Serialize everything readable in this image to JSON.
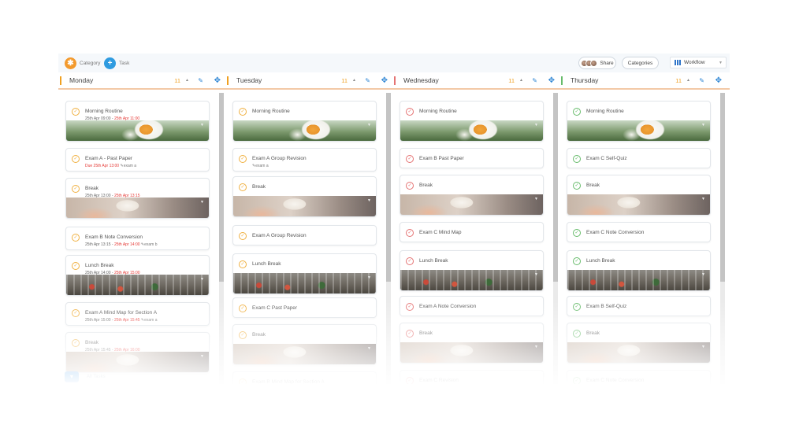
{
  "toolbar": {
    "category_label": "Category",
    "task_label": "Task",
    "share_label": "Share",
    "categories_label": "Categories",
    "view_label": "Workflow"
  },
  "filter": {
    "label": "All Tasks"
  },
  "colors": {
    "accent_orange": "#f0a020",
    "brand_blue": "#2f86d4",
    "done_red": "#e57373",
    "done_green": "#66bb6a",
    "due_red": "#e53935"
  },
  "columns": [
    {
      "title": "Monday",
      "count": "11",
      "accent": "#f0a020",
      "check_color": "#f0b040",
      "cards": [
        {
          "title": "Morning Routine",
          "sub_start": "25th Apr 09:00",
          "sub_sep": " - ",
          "sub_end": "25th Apr 11:00",
          "image": "daisy"
        },
        {
          "title": "Exam A - Past Paper",
          "sub_start": "Due 25th Apr 13:00",
          "sub_tag": "exam a"
        },
        {
          "title": "Break",
          "sub_start": "25th Apr 13:00",
          "sub_sep": " - ",
          "sub_end": "25th Apr 13:15",
          "image": "coffee"
        },
        {
          "title": "Exam B Note Conversion",
          "sub_start": "25th Apr 13:15",
          "sub_sep": " - ",
          "sub_end": "25th Apr 14:00",
          "sub_tag": "exam b"
        },
        {
          "title": "Lunch Break",
          "sub_start": "25th Apr 14:00",
          "sub_sep": " - ",
          "sub_end": "25th Apr 15:00",
          "image": "cafe"
        },
        {
          "title": "Exam A Mind Map for Section A",
          "sub_start": "25th Apr 15:00",
          "sub_sep": " - ",
          "sub_end": "25th Apr 15:45",
          "sub_tag": "exam a"
        },
        {
          "title": "Break",
          "sub_start": "25th Apr 15:45",
          "sub_sep": " - ",
          "sub_end": "25th Apr 16:00",
          "image": "coffee"
        }
      ]
    },
    {
      "title": "Tuesday",
      "count": "11",
      "accent": "#f0a020",
      "check_color": "#f0b040",
      "cards": [
        {
          "title": "Morning Routine",
          "image": "daisy"
        },
        {
          "title": "Exam A Group Revision",
          "sub_tag": "exam a"
        },
        {
          "title": "Break",
          "image": "coffee"
        },
        {
          "title": "Exam A Group Revision"
        },
        {
          "title": "Lunch Break",
          "image": "cafe"
        },
        {
          "title": "Exam C Past Paper"
        },
        {
          "title": "Break",
          "image": "coffee"
        },
        {
          "title": "Exam B Mind Map for Section A"
        }
      ]
    },
    {
      "title": "Wednesday",
      "count": "11",
      "accent": "#e57373",
      "check_color": "#e57373",
      "cards": [
        {
          "title": "Morning Routine",
          "image": "daisy"
        },
        {
          "title": "Exam B Past Paper"
        },
        {
          "title": "Break",
          "image": "coffee"
        },
        {
          "title": "Exam C Mind Map"
        },
        {
          "title": "Lunch Break",
          "image": "cafe"
        },
        {
          "title": "Exam A Note Conversion"
        },
        {
          "title": "Break",
          "image": "coffee"
        },
        {
          "title": "Exam C Revision"
        }
      ]
    },
    {
      "title": "Thursday",
      "count": "11",
      "accent": "#66bb6a",
      "check_color": "#66bb6a",
      "cards": [
        {
          "title": "Morning Routine",
          "image": "daisy"
        },
        {
          "title": "Exam C Self-Quiz"
        },
        {
          "title": "Break",
          "image": "coffee"
        },
        {
          "title": "Exam C Note Conversion"
        },
        {
          "title": "Lunch Break",
          "image": "cafe"
        },
        {
          "title": "Exam B Self-Quiz"
        },
        {
          "title": "Break",
          "image": "coffee"
        },
        {
          "title": "Exam C Note Conversion"
        }
      ]
    }
  ]
}
